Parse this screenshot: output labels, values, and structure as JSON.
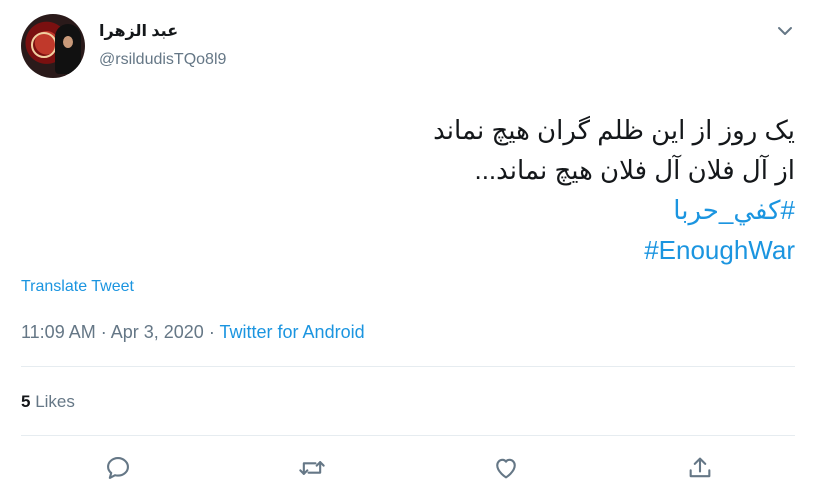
{
  "author": {
    "display_name": "عبد الزهرا",
    "handle": "@rsildudisTQo8l9"
  },
  "tweet": {
    "lines": [
      "یک روز از این ظلم گران هیچ نماند",
      "از آل فلان آل فلان هیچ نماند..."
    ],
    "hashtags": [
      "#كفي_حربا",
      "#EnoughWar"
    ]
  },
  "translate_label": "Translate Tweet",
  "meta": {
    "time": "11:09 AM",
    "date": "Apr 3, 2020",
    "separator": "·",
    "source": "Twitter for Android"
  },
  "stats": {
    "likes_count": "5",
    "likes_label": "Likes"
  },
  "icons": {
    "more": "chevron-down-icon",
    "reply": "reply-icon",
    "retweet": "retweet-icon",
    "like": "heart-icon",
    "share": "share-icon"
  },
  "colors": {
    "link": "#1b95e0",
    "muted": "#657786",
    "text": "#14171a"
  }
}
